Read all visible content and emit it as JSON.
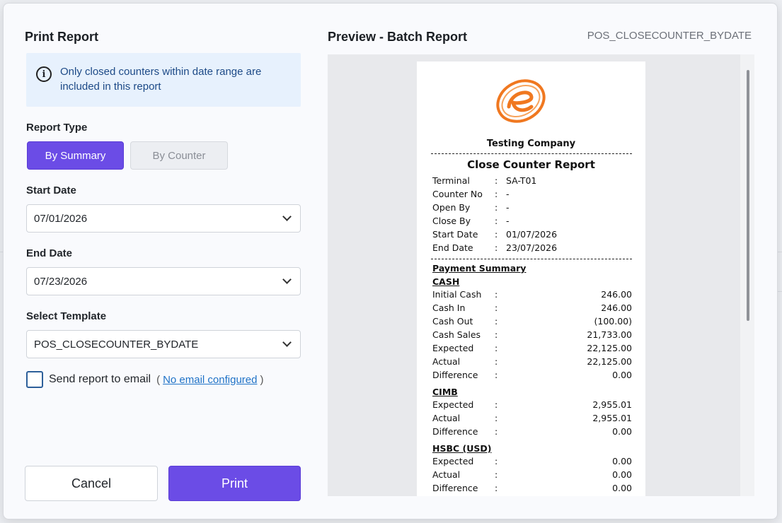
{
  "dialog": {
    "title": "Print Report",
    "info": "Only closed counters within date range are included in this report",
    "report_type_label": "Report Type",
    "report_types": [
      "By Summary",
      "By Counter"
    ],
    "start_date_label": "Start Date",
    "start_date": "07/01/2026",
    "end_date_label": "End Date",
    "end_date": "07/23/2026",
    "template_label": "Select Template",
    "template": "POS_CLOSECOUNTER_BYDATE",
    "email_label": "Send report to email",
    "email_paren_open": "(",
    "email_link": "No email configured",
    "email_paren_close": ")",
    "cancel": "Cancel",
    "print": "Print"
  },
  "preview": {
    "title": "Preview - Batch Report",
    "template_code": "POS_CLOSECOUNTER_BYDATE",
    "company": "Testing Company",
    "report_title": "Close Counter Report",
    "colon": ":",
    "header_rows": [
      {
        "k": "Terminal",
        "v": "SA-T01"
      },
      {
        "k": "Counter No",
        "v": "-"
      },
      {
        "k": "Open By",
        "v": "-"
      },
      {
        "k": "Close By",
        "v": "-"
      },
      {
        "k": "Start Date",
        "v": "01/07/2026"
      },
      {
        "k": "End Date",
        "v": "23/07/2026"
      }
    ],
    "payment_summary": "Payment Summary",
    "cash_title": "CASH",
    "cash_rows": [
      {
        "k": "Initial Cash",
        "v": "246.00"
      },
      {
        "k": "Cash In",
        "v": "246.00"
      },
      {
        "k": "Cash Out",
        "v": "(100.00)"
      },
      {
        "k": "Cash Sales",
        "v": "21,733.00"
      },
      {
        "k": "Expected",
        "v": "22,125.00"
      },
      {
        "k": "Actual",
        "v": "22,125.00"
      },
      {
        "k": "Difference",
        "v": "0.00"
      }
    ],
    "cimb_title": "CIMB",
    "cimb_rows": [
      {
        "k": "Expected",
        "v": "2,955.01"
      },
      {
        "k": "Actual",
        "v": "2,955.01"
      },
      {
        "k": "Difference",
        "v": "0.00"
      }
    ],
    "hsbc_title": "HSBC (USD)",
    "hsbc_rows": [
      {
        "k": "Expected",
        "v": "0.00"
      },
      {
        "k": "Actual",
        "v": "0.00"
      },
      {
        "k": "Difference",
        "v": "0.00"
      }
    ]
  },
  "colors": {
    "accent": "#6b4ce6",
    "info_bg": "#e7f1fd",
    "info_text": "#1d4a87",
    "link": "#1f72c7",
    "logo": "#f07820"
  }
}
